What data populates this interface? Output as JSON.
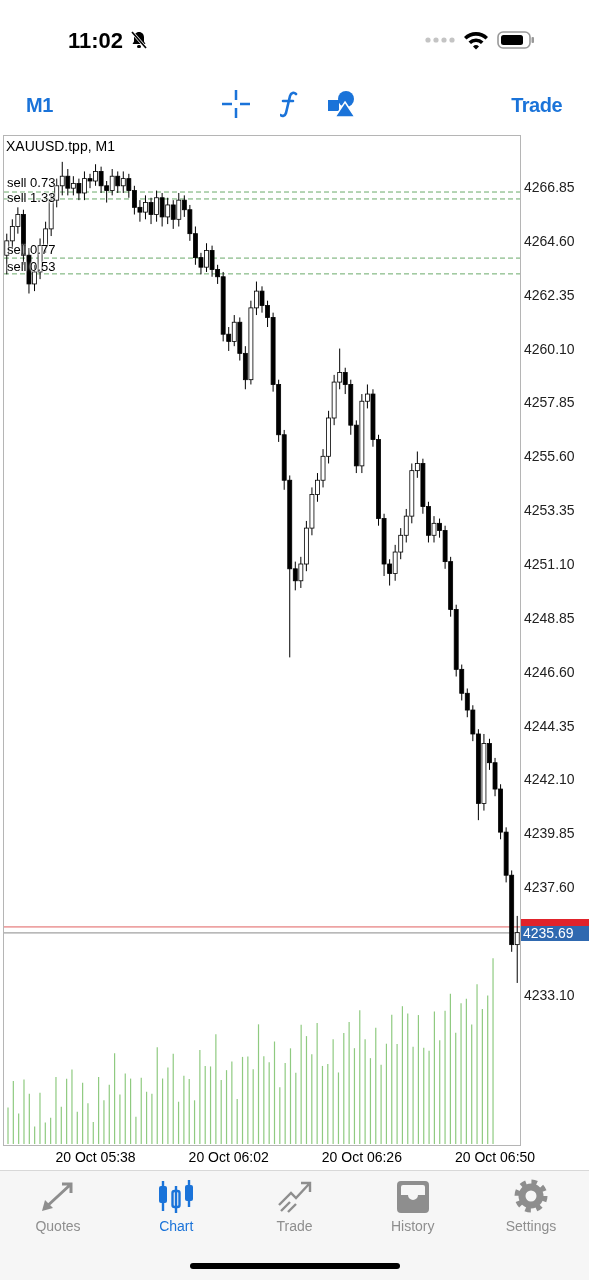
{
  "status_bar": {
    "time": "11:02"
  },
  "toolbar": {
    "timeframe": "M1",
    "trade_button": "Trade"
  },
  "chart": {
    "symbol": "XAUUSD.tpp, M1",
    "orders": [
      {
        "label": "sell 0.73"
      },
      {
        "label": "sell 1.33"
      },
      {
        "label": "sell 0.77"
      },
      {
        "label": "sell 0.53"
      }
    ],
    "chart_data": {
      "type": "candlestick",
      "ref_lines": [
        {
          "axis": "y",
          "value": 4266.64,
          "color": "#6aaa6a"
        },
        {
          "axis": "y",
          "value": 4266.35,
          "color": "#6aaa6a"
        },
        {
          "axis": "y",
          "value": 4263.88,
          "color": "#6aaa6a"
        },
        {
          "axis": "y",
          "value": 4263.22,
          "color": "#6aaa6a"
        },
        {
          "axis": "y",
          "value": 4235.94,
          "color": "#e06060"
        },
        {
          "axis": "y",
          "value": 4235.69,
          "color": "#8a8a8a"
        }
      ],
      "categories": [
        null,
        null,
        null,
        null,
        null,
        null,
        null,
        null,
        null,
        null,
        null,
        null,
        null,
        null,
        null,
        null,
        "20 Oct 05:38",
        null,
        null,
        null,
        null,
        null,
        null,
        null,
        null,
        null,
        null,
        null,
        null,
        null,
        null,
        null,
        null,
        null,
        null,
        null,
        null,
        null,
        null,
        null,
        "20 Oct 06:02",
        null,
        null,
        null,
        null,
        null,
        null,
        null,
        null,
        null,
        null,
        null,
        null,
        null,
        null,
        null,
        null,
        null,
        null,
        null,
        null,
        null,
        null,
        null,
        "20 Oct 06:26",
        null,
        null,
        null,
        null,
        null,
        null,
        null,
        null,
        null,
        null,
        null,
        null,
        null,
        null,
        null,
        null,
        null,
        null,
        null,
        null,
        null,
        null,
        null,
        "20 Oct 06:50",
        null,
        null,
        null,
        null
      ],
      "ylim": [
        4226.83,
        4268.98
      ],
      "ohlc": [
        [
          4264.0,
          4264.9,
          4263.2,
          4264.6
        ],
        [
          4264.6,
          4265.5,
          4264.3,
          4265.2
        ],
        [
          4265.2,
          4266.0,
          4264.9,
          4265.7
        ],
        [
          4265.7,
          4265.9,
          4263.6,
          4264.0
        ],
        [
          4264.0,
          4264.3,
          4262.4,
          4262.8
        ],
        [
          4262.8,
          4263.6,
          4262.5,
          4263.3
        ],
        [
          4263.3,
          4264.7,
          4263.0,
          4264.4
        ],
        [
          4264.4,
          4265.4,
          4264.1,
          4265.1
        ],
        [
          4265.1,
          4266.6,
          4264.8,
          4266.3
        ],
        [
          4266.3,
          4267.2,
          4266.0,
          4266.9
        ],
        [
          4266.9,
          4267.9,
          4266.5,
          4267.3
        ],
        [
          4267.3,
          4267.6,
          4266.5,
          4266.8
        ],
        [
          4266.8,
          4267.3,
          4266.5,
          4267.0
        ],
        [
          4267.0,
          4267.2,
          4266.3,
          4266.6
        ],
        [
          4266.6,
          4267.5,
          4266.3,
          4267.2
        ],
        [
          4267.2,
          4267.4,
          4266.8,
          4267.1
        ],
        [
          4267.1,
          4267.8,
          4266.9,
          4267.5
        ],
        [
          4267.5,
          4267.7,
          4266.6,
          4266.9
        ],
        [
          4266.9,
          4267.1,
          4266.2,
          4266.7
        ],
        [
          4266.7,
          4267.6,
          4266.5,
          4267.3
        ],
        [
          4267.3,
          4267.5,
          4266.6,
          4266.9
        ],
        [
          4266.9,
          4267.5,
          4266.6,
          4267.2
        ],
        [
          4267.2,
          4267.4,
          4266.4,
          4266.7
        ],
        [
          4266.7,
          4266.9,
          4265.7,
          4266.0
        ],
        [
          4266.0,
          4266.3,
          4265.4,
          4265.8
        ],
        [
          4265.8,
          4266.5,
          4265.5,
          4266.2
        ],
        [
          4266.2,
          4266.4,
          4265.3,
          4265.7
        ],
        [
          4265.7,
          4266.7,
          4265.4,
          4266.4
        ],
        [
          4266.4,
          4266.6,
          4265.2,
          4265.6
        ],
        [
          4265.6,
          4266.4,
          4265.3,
          4266.1
        ],
        [
          4266.1,
          4266.3,
          4265.1,
          4265.5
        ],
        [
          4265.5,
          4266.6,
          4265.2,
          4266.3
        ],
        [
          4266.3,
          4266.5,
          4265.6,
          4265.9
        ],
        [
          4265.9,
          4266.1,
          4264.6,
          4264.9
        ],
        [
          4264.9,
          4265.2,
          4263.6,
          4263.9
        ],
        [
          4263.9,
          4264.1,
          4263.2,
          4263.5
        ],
        [
          4263.5,
          4264.5,
          4263.3,
          4264.2
        ],
        [
          4264.2,
          4264.4,
          4263.1,
          4263.4
        ],
        [
          4263.4,
          4263.6,
          4262.8,
          4263.1
        ],
        [
          4263.1,
          4263.3,
          4260.4,
          4260.7
        ],
        [
          4260.7,
          4261.0,
          4260.0,
          4260.4
        ],
        [
          4260.4,
          4261.5,
          4260.2,
          4261.2
        ],
        [
          4261.2,
          4261.4,
          4259.6,
          4259.9
        ],
        [
          4259.9,
          4260.2,
          4258.4,
          4258.8
        ],
        [
          4258.8,
          4262.1,
          4258.6,
          4261.8
        ],
        [
          4261.8,
          4262.9,
          4261.5,
          4262.5
        ],
        [
          4262.5,
          4262.7,
          4261.6,
          4261.9
        ],
        [
          4261.9,
          4262.1,
          4261.0,
          4261.4
        ],
        [
          4261.4,
          4261.6,
          4258.3,
          4258.6
        ],
        [
          4258.6,
          4258.8,
          4256.2,
          4256.5
        ],
        [
          4256.5,
          4256.7,
          4254.2,
          4254.6
        ],
        [
          4254.6,
          4254.8,
          4247.2,
          4250.9
        ],
        [
          4250.9,
          4251.2,
          4250.0,
          4250.4
        ],
        [
          4250.4,
          4251.4,
          4250.1,
          4251.1
        ],
        [
          4251.1,
          4252.9,
          4250.8,
          4252.6
        ],
        [
          4252.6,
          4254.3,
          4252.3,
          4254.0
        ],
        [
          4254.0,
          4254.9,
          4253.7,
          4254.6
        ],
        [
          4254.6,
          4255.9,
          4254.3,
          4255.6
        ],
        [
          4255.6,
          4257.5,
          4255.3,
          4257.2
        ],
        [
          4257.2,
          4259.0,
          4256.9,
          4258.7
        ],
        [
          4258.7,
          4260.1,
          4258.4,
          4259.1
        ],
        [
          4259.1,
          4259.3,
          4258.2,
          4258.6
        ],
        [
          4258.6,
          4258.8,
          4256.5,
          4256.9
        ],
        [
          4256.9,
          4257.1,
          4254.9,
          4255.2
        ],
        [
          4255.2,
          4258.2,
          4254.9,
          4257.9
        ],
        [
          4257.9,
          4258.6,
          4257.6,
          4258.2
        ],
        [
          4258.2,
          4258.4,
          4256.0,
          4256.3
        ],
        [
          4256.3,
          4256.5,
          4252.7,
          4253.0
        ],
        [
          4253.0,
          4253.2,
          4250.6,
          4251.1
        ],
        [
          4251.1,
          4251.3,
          4250.2,
          4250.7
        ],
        [
          4250.7,
          4251.9,
          4250.4,
          4251.6
        ],
        [
          4251.6,
          4252.6,
          4251.3,
          4252.3
        ],
        [
          4252.3,
          4253.4,
          4252.0,
          4253.1
        ],
        [
          4253.1,
          4255.3,
          4252.8,
          4255.0
        ],
        [
          4255.0,
          4255.8,
          4254.7,
          4255.3
        ],
        [
          4255.3,
          4255.5,
          4253.2,
          4253.5
        ],
        [
          4253.5,
          4253.7,
          4252.0,
          4252.3
        ],
        [
          4252.3,
          4253.1,
          4252.0,
          4252.8
        ],
        [
          4252.8,
          4253.0,
          4252.2,
          4252.5
        ],
        [
          4252.5,
          4252.7,
          4250.9,
          4251.2
        ],
        [
          4251.2,
          4251.4,
          4248.9,
          4249.2
        ],
        [
          4249.2,
          4249.4,
          4246.4,
          4246.7
        ],
        [
          4246.7,
          4246.9,
          4245.4,
          4245.7
        ],
        [
          4245.7,
          4245.9,
          4244.7,
          4245.0
        ],
        [
          4245.0,
          4245.2,
          4243.7,
          4244.0
        ],
        [
          4244.0,
          4244.2,
          4240.4,
          4241.1
        ],
        [
          4241.1,
          4244.0,
          4240.8,
          4243.6
        ],
        [
          4243.6,
          4243.8,
          4242.5,
          4242.8
        ],
        [
          4242.8,
          4243.0,
          4241.4,
          4241.7
        ],
        [
          4241.7,
          4241.9,
          4239.6,
          4239.9
        ],
        [
          4239.9,
          4240.1,
          4237.8,
          4238.1
        ],
        [
          4238.1,
          4238.3,
          4234.9,
          4235.2
        ],
        [
          4235.2,
          4236.4,
          4233.6,
          4235.7
        ]
      ],
      "yticks": [
        {
          "value": 4266.85,
          "label": "4266.85"
        },
        {
          "value": 4264.6,
          "label": "4264.60"
        },
        {
          "value": 4262.35,
          "label": "4262.35"
        },
        {
          "value": 4260.1,
          "label": "4260.10"
        },
        {
          "value": 4257.85,
          "label": "4257.85"
        },
        {
          "value": 4255.6,
          "label": "4255.60"
        },
        {
          "value": 4253.35,
          "label": "4253.35"
        },
        {
          "value": 4251.1,
          "label": "4251.10"
        },
        {
          "value": 4248.85,
          "label": "4248.85"
        },
        {
          "value": 4246.6,
          "label": "4246.60"
        },
        {
          "value": 4244.35,
          "label": "4244.35"
        },
        {
          "value": 4242.1,
          "label": "4242.10"
        },
        {
          "value": 4239.85,
          "label": "4239.85"
        },
        {
          "value": 4237.6,
          "label": "4237.60"
        },
        {
          "value": 4233.1,
          "label": "4233.10"
        }
      ]
    },
    "bid_label": "4235.69"
  },
  "tab_bar": [
    {
      "label": "Quotes",
      "selected": false
    },
    {
      "label": "Chart",
      "selected": true
    },
    {
      "label": "Trade",
      "selected": false
    },
    {
      "label": "History",
      "selected": false
    },
    {
      "label": "Settings",
      "selected": false
    }
  ]
}
